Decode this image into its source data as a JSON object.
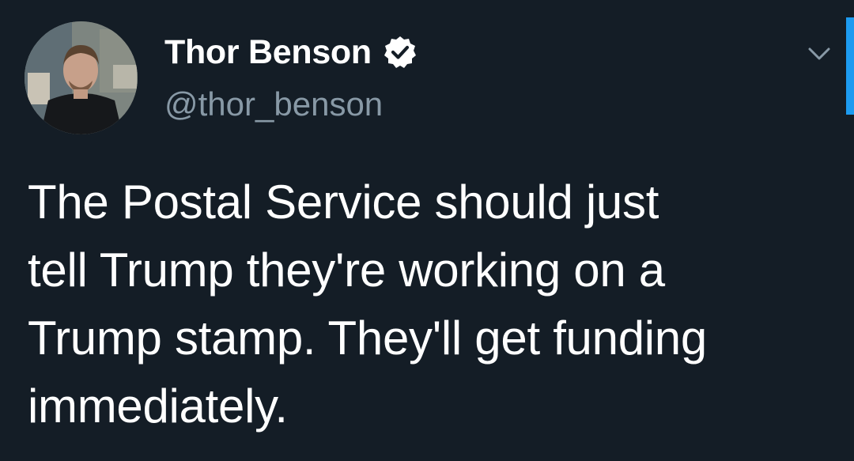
{
  "author": {
    "display_name": "Thor Benson",
    "handle": "@thor_benson",
    "verified": true
  },
  "tweet": {
    "lines": [
      "The Postal Service should just",
      "tell Trump they're working on a",
      "Trump stamp. They'll get funding",
      "immediately."
    ]
  },
  "icons": {
    "verified": "verified-badge-icon",
    "menu": "chevron-down-icon"
  },
  "colors": {
    "background": "#141d26",
    "text": "#ffffff",
    "handle": "#8899a6",
    "accent": "#1d9bf0"
  }
}
